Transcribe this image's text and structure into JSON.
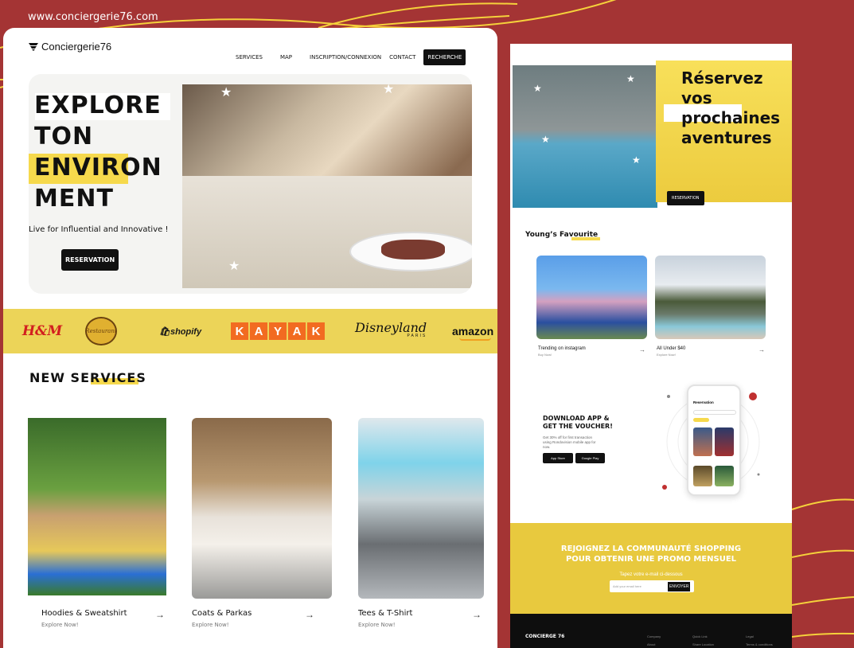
{
  "url": "www.conciergerie76.com",
  "brand": "Conciergerie76",
  "nav": {
    "services": "SERVICES",
    "map": "MAP",
    "auth": "INSCRIPTION/CONNEXION",
    "contact": "CONTACT",
    "search": "RECHERCHE"
  },
  "hero": {
    "l1": "EXPLORE",
    "l2": "TON",
    "l3": "ENVIRON",
    "l4": "MENT",
    "subtitle": "Live for Influential and Innovative !",
    "button": "RESERVATION"
  },
  "brands": {
    "hm": "H&M",
    "restaurant": "Restaurant",
    "shopify": "shopify",
    "kayak": [
      "K",
      "A",
      "Y",
      "A",
      "K"
    ],
    "disney": "Disneyland",
    "disney_sub": "PARIS",
    "amazon": "amazon"
  },
  "new_services": {
    "title": "NEW SERVICES",
    "cards": [
      {
        "name": "Hoodies & Sweatshirt",
        "sub": "Explore Now!"
      },
      {
        "name": "Coats & Parkas",
        "sub": "Explore Now!"
      },
      {
        "name": "Tees & T-Shirt",
        "sub": "Explore Now!"
      }
    ]
  },
  "right": {
    "headline_1": "Réservez",
    "headline_2": "vos",
    "headline_3": "prochaines",
    "headline_4": "aventures",
    "button": "RESERVATION",
    "fav_title_a": "Young’s Fav",
    "fav_title_b": "ourite",
    "fav_cards": [
      {
        "name": "Trending on instagram",
        "sub": "Buy Now!"
      },
      {
        "name": "All Under $40",
        "sub": "Explore Now!"
      }
    ],
    "download_1": "DOWNLOAD APP &",
    "download_2": "GET THE VOUCHER!",
    "download_sub": "Get 30% off for first transaction using Rondovision mobile app for now.",
    "appstore": "App Store",
    "googleplay": "Google Play",
    "phone_title": "Reservation",
    "promo_1": "REJOIGNEZ LA COMMUNAUTÉ SHOPPING",
    "promo_2": "POUR OBTENIR UNE PROMO MENSUEL",
    "promo_sub": "Tapez votre e-mail ci-dessous",
    "promo_placeholder": "Add your email here",
    "promo_send": "ENVOYER",
    "footer_brand": "CONCIERGE 76",
    "footer_cols": [
      "Company",
      "Quick Link",
      "Legal"
    ],
    "footer_items": [
      "About",
      "Share Location",
      "Terms & conditions"
    ]
  },
  "colors": {
    "background": "#a43434",
    "yellow": "#ecd458",
    "dark": "#111111",
    "kayak": "#f26b21"
  }
}
